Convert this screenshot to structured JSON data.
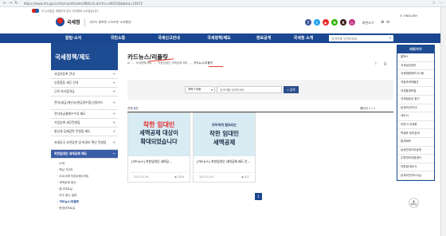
{
  "browser": {
    "url": "https://www.nts.go.kr/nts/na/ntt/selectNttList.do?mi=40015&bbsId=10672"
  },
  "topstrip": {
    "slogan": "이 누리집은 대한민국 공식 전자정부 누리집입니다."
  },
  "header": {
    "logo_name": "국세청",
    "tagline": "국민이 행복한 스마트한 국세행정",
    "english": "ENGLISH",
    "my_label": "화면크기",
    "sitemap": "사이트맵",
    "social": [
      {
        "name": "facebook",
        "glyph": "f",
        "color": "#3b5998"
      },
      {
        "name": "twitter",
        "glyph": "t",
        "color": "#1da1f2"
      },
      {
        "name": "youtube",
        "glyph": "▶",
        "color": "#e52d27"
      },
      {
        "name": "naver",
        "glyph": "N",
        "color": "#2db400"
      },
      {
        "name": "kakao",
        "glyph": "K",
        "color": "#3a1d1d"
      },
      {
        "name": "instagram",
        "glyph": "◎",
        "color": "#c13584"
      }
    ]
  },
  "gnb": {
    "items": [
      "알림·소식",
      "국민소통",
      "국세신고안내",
      "국세정책/제도",
      "정보공개",
      "국세청 소개"
    ],
    "search_placeholder": "검색어를 입력하세요"
  },
  "lnb": {
    "title": "국세정책/제도",
    "items": [
      {
        "label": "사업자등록 안내",
        "tall": false
      },
      {
        "label": "신용협동 세무 안내",
        "tall": false
      },
      {
        "label": "근로·자녀장려금",
        "tall": false
      },
      {
        "label": "전자(세금)계산서/현금영수증/신용카드",
        "tall": true
      },
      {
        "label": "전자지급결제수수료 제도",
        "tall": false
      },
      {
        "label": "가업승계 세무컨설팅",
        "tall": false
      },
      {
        "label": "법인세 공제감면 컨설팅 제도",
        "tall": false
      },
      {
        "label": "과세당국 사전답변 및 비영리 확인 컨설팅",
        "tall": true
      },
      {
        "label": "착한임대인 세액공제 제도",
        "tall": false,
        "active": true
      }
    ],
    "sub_items": [
      {
        "label": "· 소개",
        "current": false
      },
      {
        "label": "· 핵심 가이드",
        "current": false
      },
      {
        "label": "· 주요사례 작성요령(사례)",
        "current": false
      },
      {
        "label": "· 세액공제 계산",
        "current": false
      },
      {
        "label": "· 참고자료실",
        "current": false
      },
      {
        "label": "· 자주 묻는 질문",
        "current": false
      },
      {
        "label": "· 카드뉴스/리플릿",
        "current": true
      },
      {
        "label": "· 동영상자료실",
        "current": false
      }
    ]
  },
  "page": {
    "title": "카드뉴스/리플릿",
    "breadcrumb": [
      "국세정책/제도",
      "착한임대인 세액공제 제도",
      "카드뉴스/리플릿"
    ],
    "search_select": "제목+내용",
    "search_placeholder": "검색어를 입력하세요",
    "search_button": "검색",
    "total_prefix": "전체 ",
    "total_count": "2",
    "total_suffix": "건",
    "page_info": "페이지 1 / 1"
  },
  "cards": [
    {
      "thumb_line1": "착한 임대인",
      "thumb_line2": "세액공제 대상이",
      "thumb_line3": "확대되었습니다",
      "title": "[카드뉴스] 착한임대인 세액공...",
      "date": "2022.01.26.",
      "views": "1829"
    },
    {
      "thumb_line1": "모두에게 필요되는",
      "thumb_line2": "착한 임대인",
      "thumb_line3": "세액공제",
      "title": "[카드뉴스] 착한임대인 세액공제 제도 안...",
      "date": "2022.01.05.",
      "views": "822"
    }
  ],
  "pager": {
    "current": "1"
  },
  "quick": {
    "title": "바로가기",
    "items": [
      "홈택스",
      "국세상담센터",
      "국세법령정보시스템",
      "국립조세박물관",
      "국세통계포털",
      "국세청유공 찾기",
      "납세자권익24",
      "세무서",
      "어린이 국세청",
      "학생후 위치검색",
      "탈세제보",
      "납세관계국과공채",
      "주류면허지원센터",
      "지방청/세무서",
      "납세자전자도서실"
    ]
  },
  "topbtn": {
    "line1": "TOP",
    "line2": "맨위로"
  }
}
